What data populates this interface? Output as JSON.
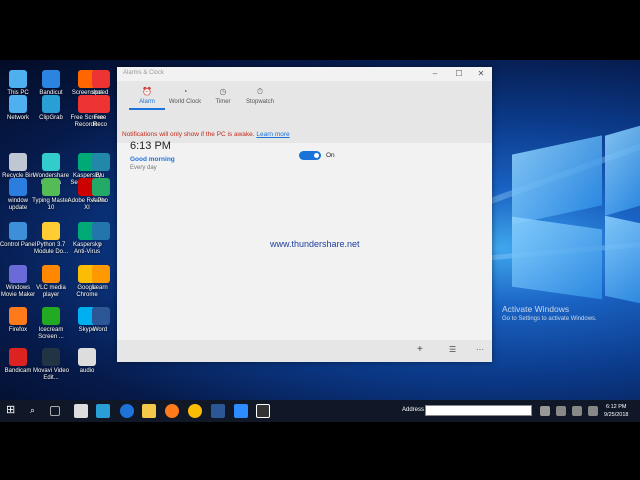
{
  "desktop": {
    "icons": [
      {
        "label": "This PC",
        "color": "#4fb0f0"
      },
      {
        "label": "Network",
        "color": "#4fb0f0"
      },
      {
        "label": "Recycle Bin",
        "color": "#bfc8d2"
      },
      {
        "label": "window update",
        "color": "#2b7de0"
      },
      {
        "label": "Control Panel",
        "color": "#3c8fd8"
      },
      {
        "label": "Windows Movie Maker",
        "color": "#6a6ad8"
      },
      {
        "label": "Firefox",
        "color": "#ff7a1a"
      },
      {
        "label": "Bandicam",
        "color": "#d22"
      },
      {
        "label": "Bandicut",
        "color": "#2b84e0"
      },
      {
        "label": "ClipGrab",
        "color": "#2a9fd6"
      },
      {
        "label": "Wondershare Filmora",
        "color": "#3cc"
      },
      {
        "label": "Typing Master 10",
        "color": "#5b5"
      },
      {
        "label": "Python 3.7 Module Do...",
        "color": "#ffcc33"
      },
      {
        "label": "VLC media player",
        "color": "#f80"
      },
      {
        "label": "Icecream Screen ...",
        "color": "#2a2"
      },
      {
        "label": "Movavi Video Edit...",
        "color": "#234"
      },
      {
        "label": "Screenshot",
        "color": "#f60"
      },
      {
        "label": "Free Screen Recorder",
        "color": "#e33"
      },
      {
        "label": "Kaspersky Secure Co...",
        "color": "#0a7"
      },
      {
        "label": "Adobe Reader XI",
        "color": "#c00"
      },
      {
        "label": "Kaspersky Anti-Virus",
        "color": "#0a7"
      },
      {
        "label": "Google Chrome",
        "color": "#fbbc05"
      },
      {
        "label": "Skype",
        "color": "#00aff0"
      },
      {
        "label": "audio",
        "color": "#ddd"
      },
      {
        "label": "speed Free O...",
        "color": "#e33"
      },
      {
        "label": "Free Reco",
        "color": "#e33"
      },
      {
        "label": "Blu",
        "color": "#28a"
      },
      {
        "label": "A Pho",
        "color": "#2a6"
      },
      {
        "label": "p",
        "color": "#27a"
      },
      {
        "label": "Learn",
        "color": "#f90"
      },
      {
        "label": "Word",
        "color": "#2b5797"
      }
    ],
    "activate": {
      "line1": "Activate Windows",
      "line2": "Go to Settings to activate Windows."
    }
  },
  "app": {
    "title": "Alarms & Clock",
    "window_buttons": {
      "minimize": "–",
      "maximize": "☐",
      "close": "✕"
    },
    "tabs": [
      {
        "label": "Alarm",
        "icon": "⏰",
        "icon_name": "alarm-icon"
      },
      {
        "label": "World Clock",
        "icon": "◔",
        "icon_name": "globe-icon"
      },
      {
        "label": "Timer",
        "icon": "◷",
        "icon_name": "timer-icon"
      },
      {
        "label": "Stopwatch",
        "icon": "⏱",
        "icon_name": "stopwatch-icon"
      }
    ],
    "notice": {
      "text": "Notifications will only show if the PC is awake.",
      "link": "Learn more"
    },
    "alarm": {
      "time": "6:13 PM",
      "name": "Good morning",
      "repeat": "Every day",
      "enabled": true,
      "toggle_label": "On"
    },
    "watermark": "www.thundershare.net",
    "appbar": {
      "add": "+",
      "select": "☰",
      "more": "···"
    }
  },
  "taskbar": {
    "start": "⊞",
    "search": "⌕",
    "address_label": "Address",
    "time": "6:12 PM",
    "date": "9/25/2018"
  },
  "colors": {
    "accent": "#1a73d9",
    "warning": "#c42b1c"
  }
}
